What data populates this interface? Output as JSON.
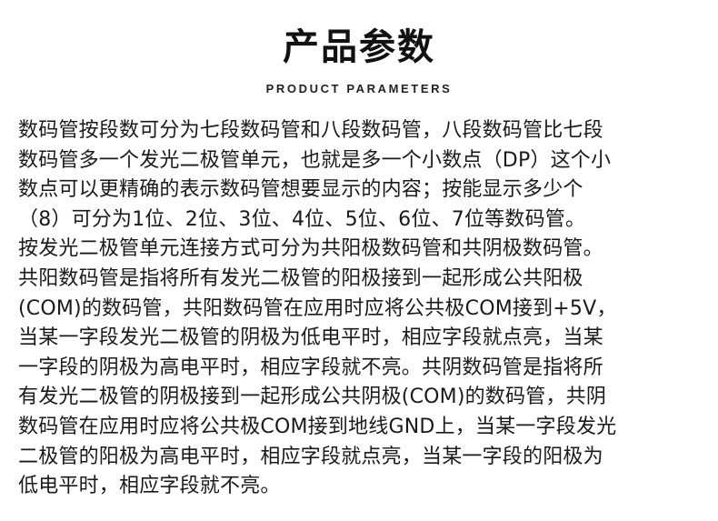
{
  "header": {
    "title": "产品参数",
    "subtitle": "PRODUCT PARAMETERS"
  },
  "description": {
    "lines": [
      "数码管按段数可分为七段数码管和八段数码管，八段数码管比七段",
      "数码管多一个发光二极管单元，也就是多一个小数点（DP）这个小",
      "数点可以更精确的表示数码管想要显示的内容；按能显示多少个",
      "（8）可分为1位、2位、3位、4位、5位、6位、7位等数码管。",
      "按发光二极管单元连接方式可分为共阳极数码管和共阴极数码管。",
      "共阳数码管是指将所有发光二极管的阳极接到一起形成公共阳极",
      "(COM)的数码管，共阳数码管在应用时应将公共极COM接到+5V，",
      "当某一字段发光二极管的阴极为低电平时，相应字段就点亮，当某",
      "一字段的阴极为高电平时，相应字段就不亮。共阴数码管是指将所",
      "有发光二极管的阴极接到一起形成公共阴极(COM)的数码管，共阴",
      "数码管在应用时应将公共极COM接到地线GND上，当某一字段发光",
      "二极管的阳极为高电平时，相应字段就点亮，当某一字段的阳极为",
      "低电平时，相应字段就不亮。"
    ]
  }
}
